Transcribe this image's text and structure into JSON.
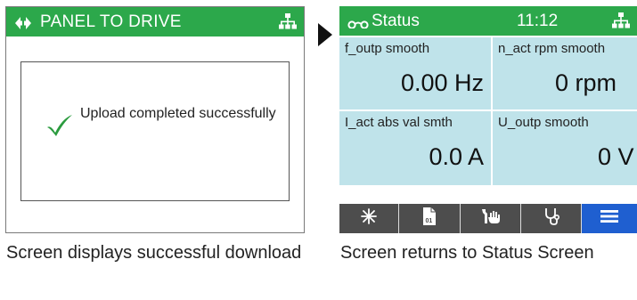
{
  "left_panel": {
    "title": "PANEL TO DRIVE",
    "dialog_message": "Upload completed successfully",
    "caption": "Screen displays successful download",
    "icons": {
      "header_left": "transfer-arrows-icon",
      "header_right": "network-icon",
      "dialog": "checkmark-icon"
    }
  },
  "right_panel": {
    "title": "Status",
    "time": "11:12",
    "caption": "Screen returns to Status Screen",
    "cells": [
      {
        "label": "f_outp smooth",
        "value": "0.00 Hz"
      },
      {
        "label": "n_act rpm smooth",
        "value": "0 rpm"
      },
      {
        "label": "I_act abs val smth",
        "value": "0.0 A"
      },
      {
        "label": "U_outp smooth",
        "value": "0 V"
      }
    ],
    "toolbar": [
      "asterisk-icon",
      "parameter-file-icon",
      "hand-wrench-icon",
      "stethoscope-icon",
      "menu-icon"
    ],
    "icons": {
      "header_left": "glasses-icon",
      "header_right": "network-icon"
    }
  },
  "colors": {
    "header_green": "#2ca84b",
    "cell_bg": "#bfe3ea",
    "toolbar_bg": "#4d4d4d",
    "active_blue": "#1f5fd0"
  }
}
